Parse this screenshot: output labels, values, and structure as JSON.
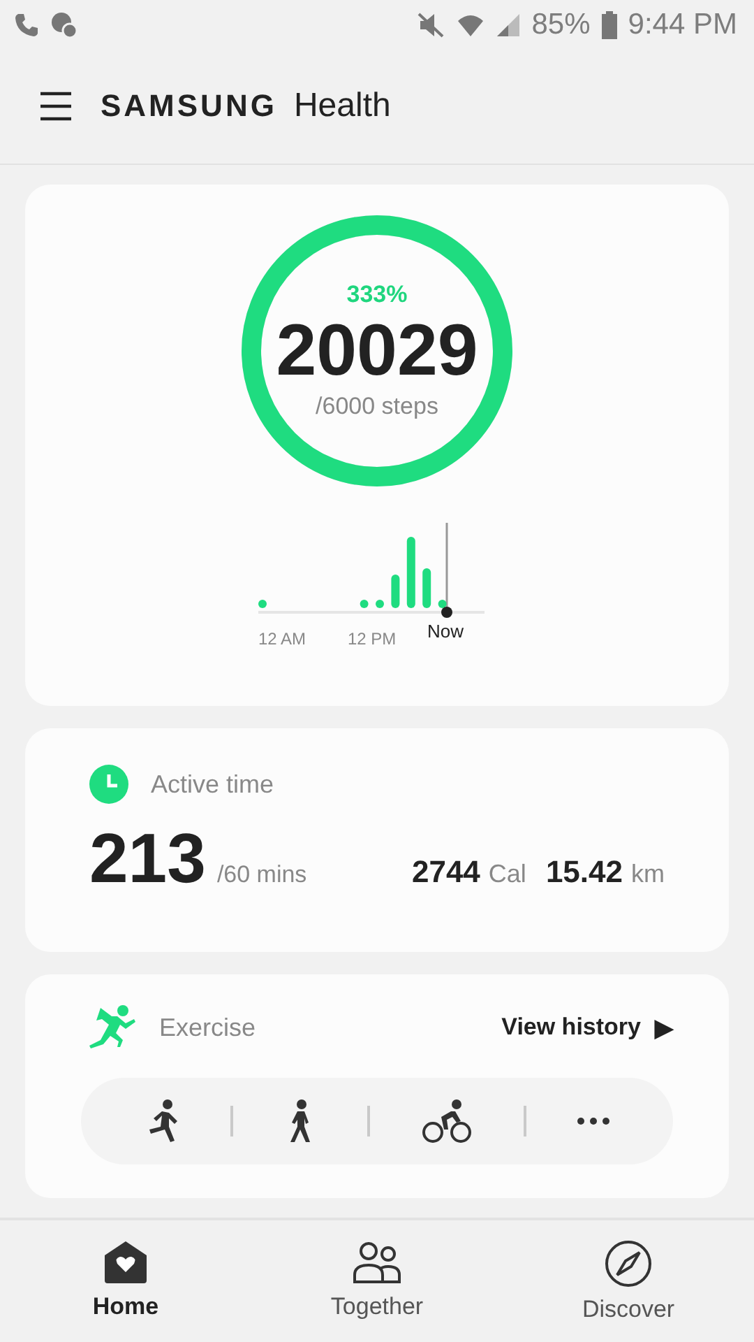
{
  "status_bar": {
    "battery": "85%",
    "time": "9:44 PM"
  },
  "header": {
    "brand": "SAMSUNG",
    "title": "Health"
  },
  "steps": {
    "percent": "333%",
    "count": "20029",
    "goal": "/6000 steps",
    "level": 1,
    "axis": [
      "12 AM",
      "12 PM"
    ],
    "now": "Now"
  },
  "active": {
    "title": "Active time",
    "value": "213",
    "goal": "/60 mins",
    "calories": "2744",
    "calories_unit": "Cal",
    "distance": "15.42",
    "distance_unit": "km"
  },
  "exercise": {
    "title": "Exercise",
    "link": "View history",
    "link_icon": "▶",
    "types": [
      {
        "kind": "run"
      },
      {
        "kind": "walk"
      },
      {
        "kind": "bike"
      },
      {
        "kind": "more"
      }
    ]
  },
  "nav": [
    {
      "label": "Home",
      "kind": "home",
      "selected": true
    },
    {
      "label": "Together",
      "kind": "together",
      "selected": false
    },
    {
      "label": "Discover",
      "kind": "discover",
      "selected": false
    }
  ]
}
